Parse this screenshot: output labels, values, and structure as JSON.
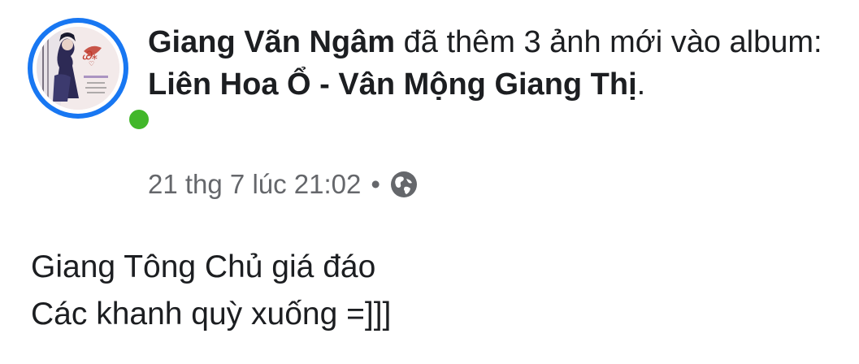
{
  "post": {
    "author_name": "Giang Vãn Ngâm",
    "action_text": " đã thêm 3 ảnh mới vào album: ",
    "album_name": "Liên Hoa Ổ - Vân Mộng Giang Thị",
    "trailing_punct": ".",
    "timestamp": "21 thg 7 lúc 21:02",
    "separator": "•",
    "privacy_icon": "globe-icon",
    "online_status_color": "#42b72a",
    "avatar_ring_color": "#1877f2",
    "body_lines": [
      "Giang Tông Chủ giá đáo",
      "Các khanh quỳ xuống =]]]"
    ]
  }
}
